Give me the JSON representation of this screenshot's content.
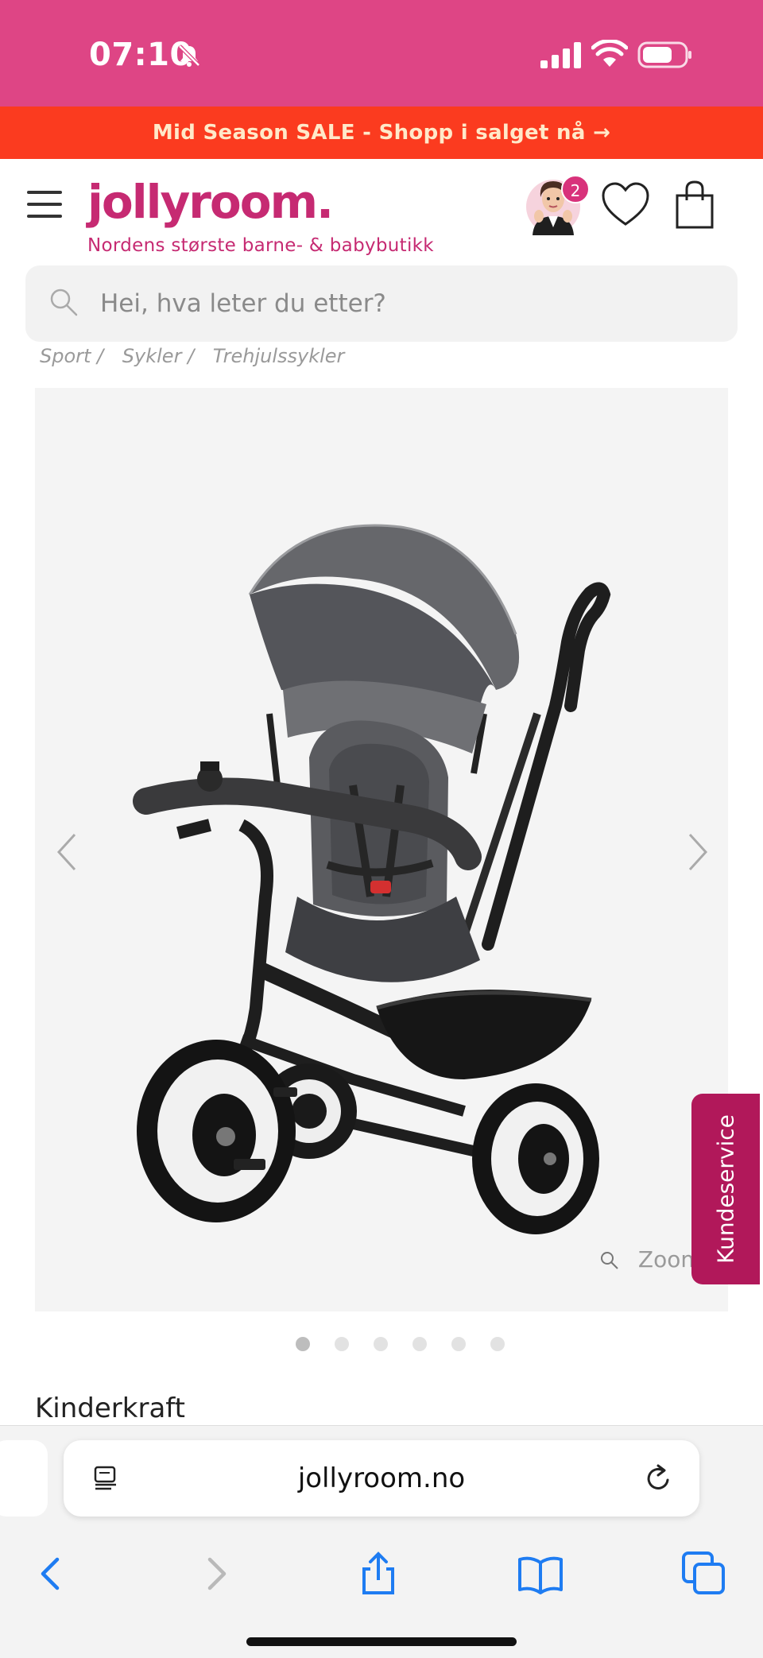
{
  "status": {
    "time": "07:10"
  },
  "promo": {
    "text": "Mid Season SALE - Shopp i salget nå →"
  },
  "header": {
    "logo": "jollyroom.",
    "tagline": "Nordens største barne- & babybutikk",
    "avatar_badge": "2"
  },
  "search": {
    "placeholder": "Hei, hva leter du etter?"
  },
  "breadcrumb": [
    "Sport /",
    "Sykler /",
    "Trehjulssykler"
  ],
  "gallery": {
    "zoom_label": "Zoom",
    "image_count": 6,
    "active_index": 0,
    "colors": {
      "frame": "#1e1e1e",
      "fabric": "#5c5d60",
      "canopy": "#6b6c6f",
      "wheel_white": "#f1f1f1"
    }
  },
  "kundeservice": {
    "label": "Kundeservice"
  },
  "product": {
    "brand": "Kinderkraft"
  },
  "browser": {
    "url": "jollyroom.no"
  },
  "colors": {
    "status_bar": "#de4585",
    "promo_bar": "#fb3b1f",
    "brand": "#c62a72",
    "kundeservice": "#b1185a",
    "safari_blue": "#1e7cf2"
  }
}
